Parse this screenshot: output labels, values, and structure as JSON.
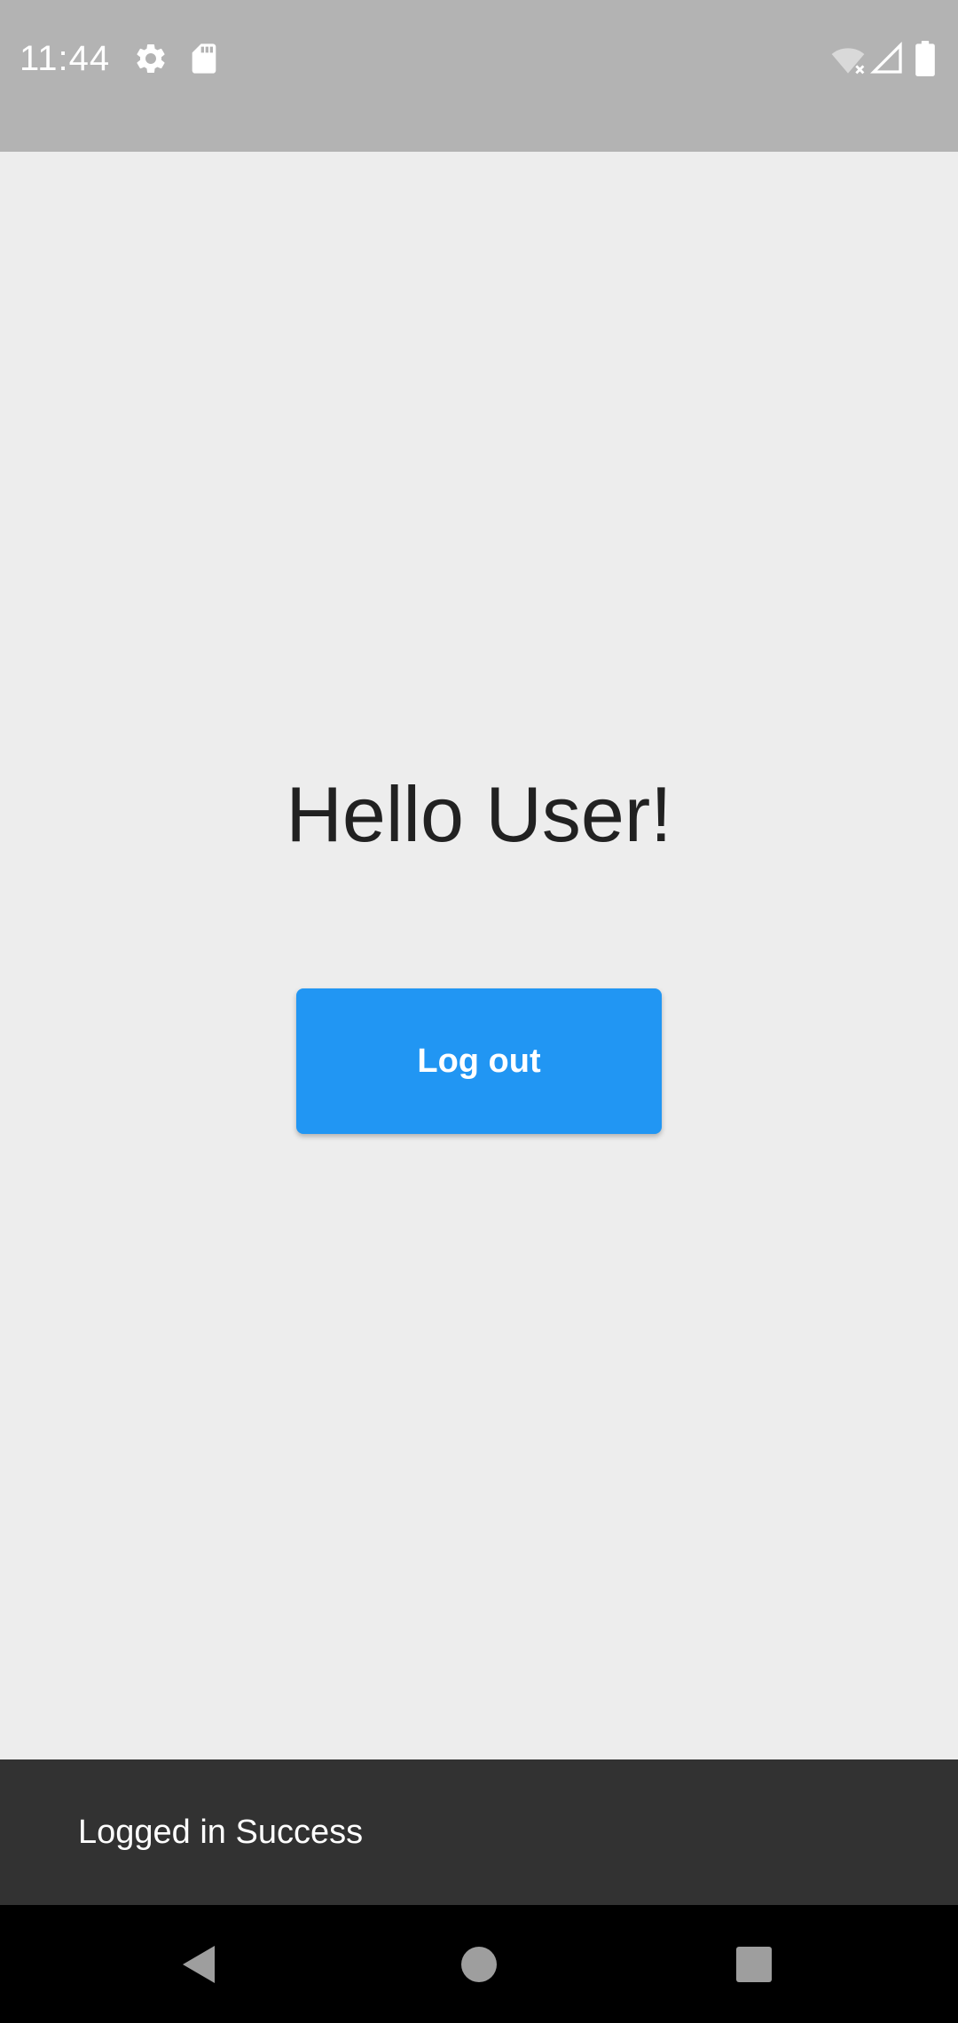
{
  "status_bar": {
    "time": "11:44",
    "left_icons": [
      "settings-icon",
      "sd-card-icon"
    ],
    "right_icons": [
      "wifi-off-icon",
      "cell-signal-icon",
      "battery-icon"
    ]
  },
  "main": {
    "greeting": "Hello User!",
    "logout_label": "Log out"
  },
  "snackbar": {
    "message": "Logged in Success"
  },
  "nav_bar": {
    "buttons": [
      "back-icon",
      "home-icon",
      "recents-icon"
    ]
  },
  "colors": {
    "status_bar_bg": "#b3b3b3",
    "background": "#ededed",
    "button": "#2196f3",
    "snackbar_bg": "#323232",
    "nav_bg": "#000000"
  }
}
